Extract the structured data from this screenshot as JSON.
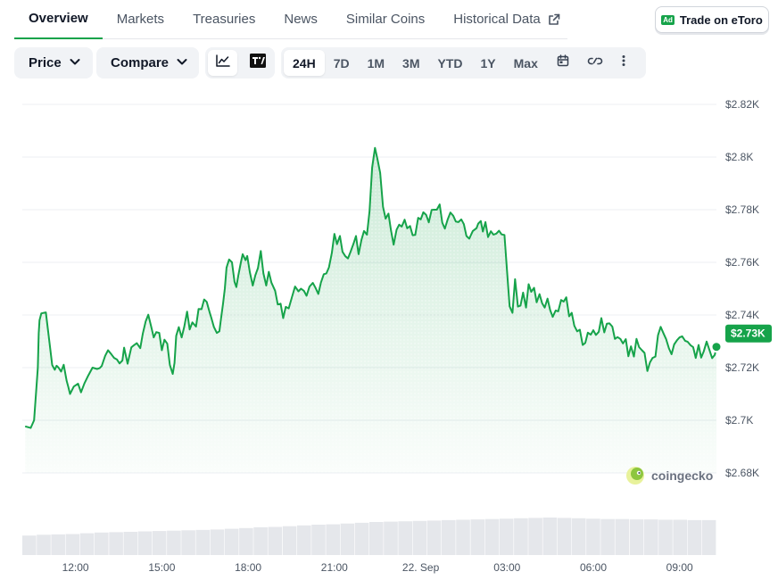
{
  "tabs": [
    {
      "label": "Overview",
      "active": true
    },
    {
      "label": "Markets"
    },
    {
      "label": "Treasuries"
    },
    {
      "label": "News"
    },
    {
      "label": "Similar Coins"
    },
    {
      "label": "Historical Data",
      "icon": "external-link-icon"
    }
  ],
  "trade_button": {
    "badge": "Ad",
    "label": "Trade on eToro"
  },
  "toolbar": {
    "price_dropdown": "Price",
    "compare_dropdown": "Compare",
    "chart_types": [
      {
        "icon": "line-chart-icon",
        "active": true
      },
      {
        "icon": "tradingview-icon",
        "label": "TV"
      }
    ],
    "ranges": [
      "24H",
      "7D",
      "1M",
      "3M",
      "YTD",
      "1Y",
      "Max"
    ],
    "active_range": "24H",
    "extra_icons": [
      "calendar-icon",
      "link-icon",
      "more-vertical-icon"
    ]
  },
  "colors": {
    "line": "#16a34a",
    "accent": "#16a34a",
    "fill": "#d8f0de",
    "grid": "#eceff3"
  },
  "watermark": "coingecko",
  "chart_data": {
    "type": "area",
    "ylim": [
      2670,
      2825
    ],
    "y_ticks": [
      2680,
      2700,
      2720,
      2740,
      2760,
      2780,
      2800,
      2820
    ],
    "y_tick_labels": [
      "$2.68K",
      "$2.7K",
      "$2.72K",
      "$2.74K",
      "$2.76K",
      "$2.78K",
      "$2.8K",
      "$2.82K"
    ],
    "x_tick_labels": [
      "12:00",
      "15:00",
      "18:00",
      "21:00",
      "22. Sep",
      "03:00",
      "06:00",
      "09:00"
    ],
    "x_tick_hours": [
      1.75,
      4.75,
      7.75,
      10.75,
      13.75,
      16.75,
      19.75,
      22.75
    ],
    "current_price_label": "$2.73K",
    "grid": true,
    "series": [
      {
        "hours": [
          0,
          0.19,
          0.31,
          0.44,
          0.47,
          0.5,
          0.56,
          0.72,
          0.84,
          0.94,
          1.03,
          1.09,
          1.16,
          1.25,
          1.34,
          1.44,
          1.5,
          1.56,
          1.69,
          1.84,
          1.94,
          2.06,
          2.19,
          2.34,
          2.5,
          2.59,
          2.66,
          2.78,
          2.88,
          3,
          3.09,
          3.19,
          3.28,
          3.38,
          3.44,
          3.56,
          3.69,
          3.78,
          3.88,
          4,
          4.09,
          4.19,
          4.28,
          4.38,
          4.47,
          4.56,
          4.66,
          4.75,
          4.84,
          4.94,
          5.03,
          5.13,
          5.19,
          5.25,
          5.34,
          5.44,
          5.53,
          5.63,
          5.72,
          5.81,
          5.94,
          6.03,
          6.13,
          6.22,
          6.31,
          6.41,
          6.47,
          6.56,
          6.66,
          6.75,
          6.81,
          6.88,
          6.94,
          7,
          7.09,
          7.19,
          7.28,
          7.34,
          7.41,
          7.5,
          7.56,
          7.66,
          7.72,
          7.81,
          7.91,
          8,
          8.09,
          8.19,
          8.28,
          8.38,
          8.47,
          8.56,
          8.69,
          8.78,
          8.88,
          8.97,
          9.06,
          9.16,
          9.28,
          9.38,
          9.5,
          9.59,
          9.69,
          9.78,
          9.88,
          10,
          10.09,
          10.19,
          10.28,
          10.38,
          10.47,
          10.56,
          10.66,
          10.75,
          10.84,
          10.94,
          11.03,
          11.13,
          11.22,
          11.31,
          11.41,
          11.5,
          11.59,
          11.69,
          11.78,
          11.88,
          11.97,
          12.06,
          12.16,
          12.25,
          12.34,
          12.44,
          12.53,
          12.63,
          12.72,
          12.81,
          12.91,
          13,
          13.09,
          13.19,
          13.28,
          13.38,
          13.47,
          13.56,
          13.66,
          13.75,
          13.84,
          13.94,
          14.03,
          14.13,
          14.22,
          14.31,
          14.41,
          14.5,
          14.59,
          14.69,
          14.78,
          14.88,
          14.97,
          15.06,
          15.16,
          15.25,
          15.34,
          15.44,
          15.5,
          15.56,
          15.69,
          15.75,
          15.84,
          15.91,
          16,
          16.09,
          16.19,
          16.28,
          16.38,
          16.47,
          16.56,
          16.66,
          16.75,
          16.84,
          16.94,
          17.03,
          17.13,
          17.22,
          17.31,
          17.41,
          17.5,
          17.59,
          17.69,
          17.78,
          17.88,
          17.97,
          18.06,
          18.16,
          18.25,
          18.34,
          18.44,
          18.53,
          18.63,
          18.72,
          18.81,
          18.91,
          19,
          19.09,
          19.19,
          19.28,
          19.38,
          19.47,
          19.56,
          19.66,
          19.75,
          19.84,
          19.94,
          20.03,
          20.13,
          20.22,
          20.31,
          20.41,
          20.5,
          20.59,
          20.69,
          20.78,
          20.88,
          20.97,
          21.06,
          21.16,
          21.25,
          21.34,
          21.44,
          21.53,
          21.63,
          21.72,
          21.81,
          21.91,
          22,
          22.09,
          22.19,
          22.28,
          22.38,
          22.47,
          22.56,
          22.66,
          22.75,
          22.84,
          22.94,
          23.03,
          23.13,
          23.22,
          23.31,
          23.41,
          23.5,
          23.59,
          23.69,
          23.78,
          23.88,
          23.97,
          24.03
        ],
        "values": [
          2697.7,
          2697.1,
          2700,
          2720,
          2733,
          2738,
          2740.6,
          2741,
          2730,
          2721,
          2719.2,
          2720.7,
          2720,
          2718.5,
          2721.1,
          2715,
          2712.6,
          2710,
          2712.8,
          2713.9,
          2710.6,
          2714,
          2716.9,
          2720,
          2719.5,
          2719.8,
          2720.6,
          2724.5,
          2726.6,
          2725,
          2723.7,
          2723.1,
          2721.6,
          2722.7,
          2727.6,
          2721.5,
          2727.7,
          2728.5,
          2729.3,
          2727.4,
          2733,
          2737.6,
          2740.1,
          2735.7,
          2731.5,
          2733.5,
          2733.2,
          2726.6,
          2730.6,
          2729.1,
          2721,
          2717.6,
          2721.8,
          2732.1,
          2735.4,
          2731.5,
          2735.5,
          2741.3,
          2734.5,
          2737.2,
          2735.6,
          2742.3,
          2742.2,
          2745.9,
          2745,
          2741.1,
          2739,
          2735.5,
          2733.2,
          2733.8,
          2738.8,
          2744.3,
          2750,
          2758,
          2761.1,
          2760,
          2752.5,
          2750.6,
          2755,
          2760,
          2763.1,
          2760.8,
          2762.4,
          2756.3,
          2751.2,
          2755.1,
          2757.8,
          2764.3,
          2755.9,
          2751.2,
          2756.4,
          2752.3,
          2749.2,
          2744,
          2744.3,
          2738.8,
          2743.1,
          2742.5,
          2747,
          2750.8,
          2749,
          2750,
          2749.2,
          2747.3,
          2750.7,
          2752.2,
          2750.4,
          2748,
          2752.3,
          2755.5,
          2755.8,
          2758.1,
          2763.5,
          2770.8,
          2766.9,
          2770,
          2764,
          2762.3,
          2761.5,
          2764,
          2767,
          2770,
          2763.1,
          2768.5,
          2771.9,
          2770.5,
          2779.5,
          2796,
          2803.5,
          2799,
          2794,
          2781.1,
          2776.6,
          2778.5,
          2772,
          2766.7,
          2772.4,
          2774.3,
          2773.6,
          2776.2,
          2772.9,
          2773.8,
          2770.3,
          2770.4,
          2776.9,
          2776.3,
          2779,
          2778,
          2775.2,
          2779.9,
          2780,
          2780,
          2782,
          2775.1,
          2772.8,
          2776.4,
          2778.9,
          2777.7,
          2775.5,
          2775.3,
          2776.3,
          2774.5,
          2770,
          2769,
          2770.5,
          2771.9,
          2773,
          2774.7,
          2775.7,
          2771.7,
          2775.3,
          2769.6,
          2771.8,
          2770.5,
          2770.9,
          2772,
          2770.6,
          2770.4,
          2756.7,
          2743.3,
          2740.8,
          2753.6,
          2743.2,
          2743.6,
          2748.5,
          2742.8,
          2751.7,
          2748.8,
          2750.3,
          2744.8,
          2747.9,
          2744.5,
          2742.8,
          2746.2,
          2741.9,
          2739.3,
          2741.7,
          2741.4,
          2745.7,
          2745.1,
          2746.7,
          2739.5,
          2740.8,
          2735.9,
          2733.8,
          2734.4,
          2728.6,
          2729.4,
          2733.3,
          2732.5,
          2734.2,
          2732.4,
          2733.6,
          2738.8,
          2733.4,
          2736.7,
          2736.8,
          2735.6,
          2730.9,
          2731.6,
          2730.9,
          2729.2,
          2730.8,
          2724.3,
          2728.1,
          2724.2,
          2730.9,
          2727.8,
          2726.6,
          2725.6,
          2718.7,
          2722,
          2723.7,
          2724.2,
          2732.3,
          2735.5,
          2733,
          2730.8,
          2727.3,
          2725.1,
          2728.8,
          2730.4,
          2731.5,
          2731.9,
          2730.2,
          2729.8,
          2728.5,
          2727.8,
          2723.7,
          2728.6,
          2723.8,
          2726.2,
          2729.9,
          2727,
          2723.6,
          2724.8,
          2727.9,
          2727.4,
          2729.5,
          2731.5,
          2730.1,
          2725.5,
          2726.2,
          2730,
          2742.2,
          2746.9,
          2752.1,
          2745.6,
          2735.8,
          2736.9
        ]
      }
    ],
    "volume": {
      "hours_start": 0,
      "hours_end": 24,
      "relative": [
        0.52,
        0.54,
        0.55,
        0.56,
        0.58,
        0.6,
        0.61,
        0.62,
        0.63,
        0.64,
        0.65,
        0.66,
        0.67,
        0.68,
        0.7,
        0.72,
        0.74,
        0.75,
        0.77,
        0.79,
        0.81,
        0.82,
        0.84,
        0.86,
        0.88,
        0.89,
        0.9,
        0.91,
        0.92,
        0.93,
        0.94,
        0.95,
        0.96,
        0.97,
        0.98,
        0.99,
        1.0,
        0.99,
        0.98,
        0.97,
        0.96,
        0.96,
        0.95,
        0.95,
        0.94,
        0.94,
        0.93,
        0.93
      ]
    }
  }
}
